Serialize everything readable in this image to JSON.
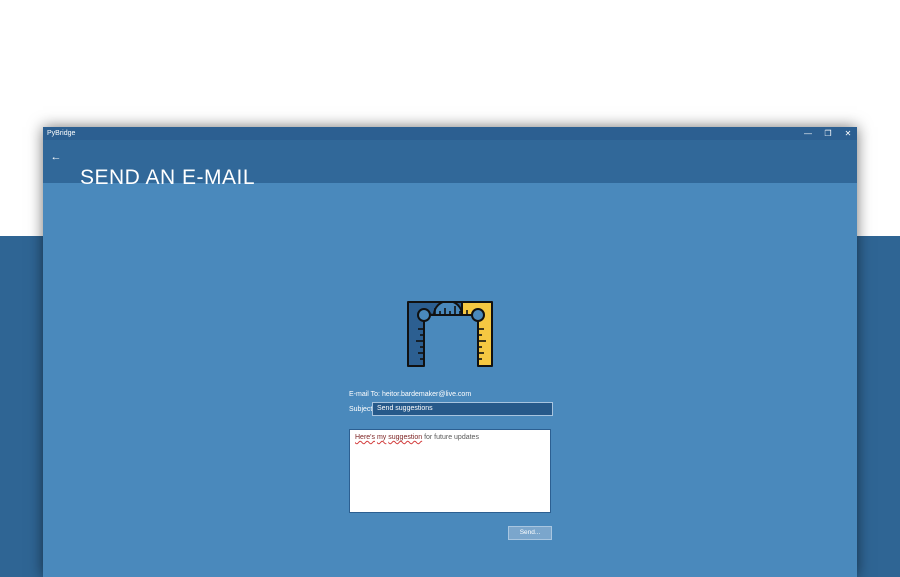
{
  "window": {
    "app_name": "PyBridge",
    "controls": {
      "minimize": "—",
      "maximize": "❐",
      "close": "✕"
    }
  },
  "header": {
    "back_icon": "←",
    "title": "SEND AN E-MAIL"
  },
  "form": {
    "email_to_label": "E-mail To:",
    "email_to_address": "heitor.bardemaker@live.com",
    "subject_label": "Subject:",
    "subject_value": "Send suggestions",
    "message_parts": {
      "misspelled_1": "Here's",
      "space_1": " ",
      "misspelled_2": "my",
      "space_2": " ",
      "misspelled_3": "suggestion",
      "rest": " for future updates"
    },
    "send_label": "Send..."
  },
  "colors": {
    "window_bg": "#4a89bc",
    "header_bg": "#316899",
    "title_bar": "#2c5f91",
    "logo_navy": "#2c5f91",
    "logo_yellow": "#f5c842"
  },
  "icons": {
    "logo": "ruler-bridge-logo",
    "back": "back-arrow-icon"
  }
}
